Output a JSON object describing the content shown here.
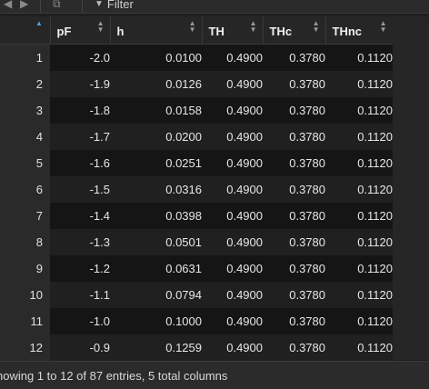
{
  "toolbar": {
    "back_icon": "arrow-left-icon",
    "forward_icon": "arrow-right-icon",
    "popout_icon": "popout-icon",
    "filter_icon": "funnel-icon",
    "filter_label": "Filter"
  },
  "table": {
    "columns": [
      "pF",
      "h",
      "TH",
      "THc",
      "THnc"
    ],
    "rows": [
      {
        "idx": "1",
        "pF": "-2.0",
        "h": "0.0100",
        "TH": "0.4900",
        "THc": "0.3780",
        "THnc": "0.1120"
      },
      {
        "idx": "2",
        "pF": "-1.9",
        "h": "0.0126",
        "TH": "0.4900",
        "THc": "0.3780",
        "THnc": "0.1120"
      },
      {
        "idx": "3",
        "pF": "-1.8",
        "h": "0.0158",
        "TH": "0.4900",
        "THc": "0.3780",
        "THnc": "0.1120"
      },
      {
        "idx": "4",
        "pF": "-1.7",
        "h": "0.0200",
        "TH": "0.4900",
        "THc": "0.3780",
        "THnc": "0.1120"
      },
      {
        "idx": "5",
        "pF": "-1.6",
        "h": "0.0251",
        "TH": "0.4900",
        "THc": "0.3780",
        "THnc": "0.1120"
      },
      {
        "idx": "6",
        "pF": "-1.5",
        "h": "0.0316",
        "TH": "0.4900",
        "THc": "0.3780",
        "THnc": "0.1120"
      },
      {
        "idx": "7",
        "pF": "-1.4",
        "h": "0.0398",
        "TH": "0.4900",
        "THc": "0.3780",
        "THnc": "0.1120"
      },
      {
        "idx": "8",
        "pF": "-1.3",
        "h": "0.0501",
        "TH": "0.4900",
        "THc": "0.3780",
        "THnc": "0.1120"
      },
      {
        "idx": "9",
        "pF": "-1.2",
        "h": "0.0631",
        "TH": "0.4900",
        "THc": "0.3780",
        "THnc": "0.1120"
      },
      {
        "idx": "10",
        "pF": "-1.1",
        "h": "0.0794",
        "TH": "0.4900",
        "THc": "0.3780",
        "THnc": "0.1120"
      },
      {
        "idx": "11",
        "pF": "-1.0",
        "h": "0.1000",
        "TH": "0.4900",
        "THc": "0.3780",
        "THnc": "0.1120"
      },
      {
        "idx": "12",
        "pF": "-0.9",
        "h": "0.1259",
        "TH": "0.4900",
        "THc": "0.3780",
        "THnc": "0.1120"
      }
    ]
  },
  "status": {
    "text": "howing 1 to 12 of 87 entries, 5 total columns"
  },
  "colors": {
    "sort_active": "#4ba3e6",
    "background": "#1f1f1f"
  }
}
